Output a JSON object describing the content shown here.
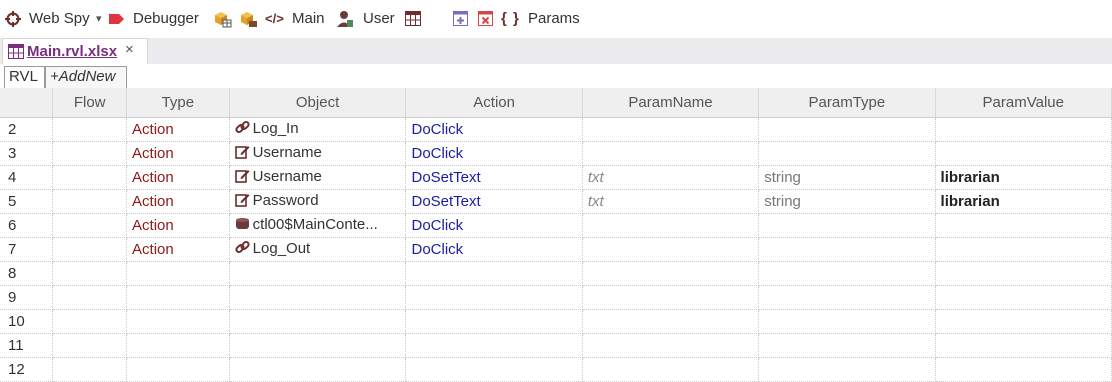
{
  "toolbar": {
    "web_spy": "Web Spy",
    "debugger": "Debugger",
    "main": "Main",
    "user": "User",
    "params": "Params",
    "params_braces": "{ }",
    "code_glyph": "</>",
    "dropdown_arrow": "▾"
  },
  "file_tab": {
    "label": "Main.rvl.xlsx",
    "close": "×"
  },
  "sheet_tabs": {
    "rvl": "RVL",
    "add_new": "+AddNew"
  },
  "table": {
    "columns": [
      "",
      "Flow",
      "Type",
      "Object",
      "Action",
      "ParamName",
      "ParamType",
      "ParamValue"
    ],
    "rows": [
      {
        "num": "2",
        "flow": "",
        "type": "Action",
        "object_icon": "link-icon",
        "object": "Log_In",
        "action": "DoClick",
        "param_name": "",
        "param_type": "",
        "param_value": ""
      },
      {
        "num": "3",
        "flow": "",
        "type": "Action",
        "object_icon": "edit-icon",
        "object": "Username",
        "action": "DoClick",
        "param_name": "",
        "param_type": "",
        "param_value": ""
      },
      {
        "num": "4",
        "flow": "",
        "type": "Action",
        "object_icon": "edit-icon",
        "object": "Username",
        "action": "DoSetText",
        "param_name": "txt",
        "param_type": "string",
        "param_value": "librarian"
      },
      {
        "num": "5",
        "flow": "",
        "type": "Action",
        "object_icon": "edit-icon",
        "object": "Password",
        "action": "DoSetText",
        "param_name": "txt",
        "param_type": "string",
        "param_value": "librarian"
      },
      {
        "num": "6",
        "flow": "",
        "type": "Action",
        "object_icon": "database-icon",
        "object": "ctl00$MainConte...",
        "action": "DoClick",
        "param_name": "",
        "param_type": "",
        "param_value": ""
      },
      {
        "num": "7",
        "flow": "",
        "type": "Action",
        "object_icon": "link-icon",
        "object": "Log_Out",
        "action": "DoClick",
        "param_name": "",
        "param_type": "",
        "param_value": ""
      },
      {
        "num": "8",
        "flow": "",
        "type": "",
        "object_icon": "",
        "object": "",
        "action": "",
        "param_name": "",
        "param_type": "",
        "param_value": ""
      },
      {
        "num": "9",
        "flow": "",
        "type": "",
        "object_icon": "",
        "object": "",
        "action": "",
        "param_name": "",
        "param_type": "",
        "param_value": ""
      },
      {
        "num": "10",
        "flow": "",
        "type": "",
        "object_icon": "",
        "object": "",
        "action": "",
        "param_name": "",
        "param_type": "",
        "param_value": ""
      },
      {
        "num": "11",
        "flow": "",
        "type": "",
        "object_icon": "",
        "object": "",
        "action": "",
        "param_name": "",
        "param_type": "",
        "param_value": ""
      },
      {
        "num": "12",
        "flow": "",
        "type": "",
        "object_icon": "",
        "object": "",
        "action": "",
        "param_name": "",
        "param_type": "",
        "param_value": ""
      }
    ]
  },
  "colors": {
    "type_text": "#8b1a1a",
    "action_text": "#1c1ca8",
    "file_tab_text": "#7b2f7f",
    "debugger_red": "#e0353e"
  }
}
